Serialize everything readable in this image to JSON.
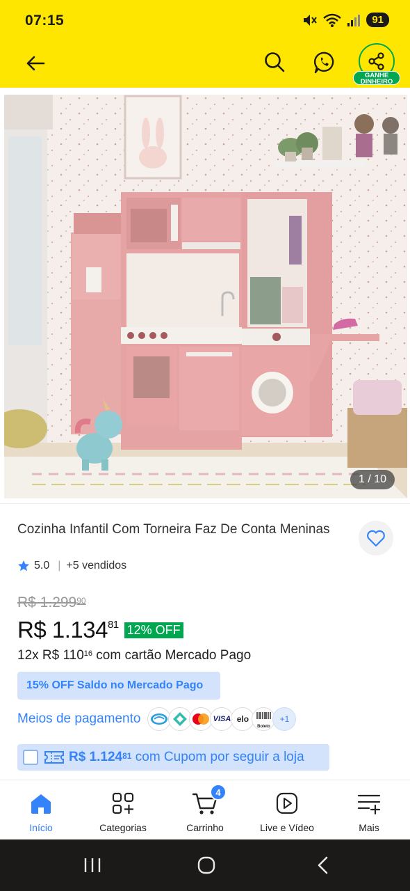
{
  "status_bar": {
    "time": "07:15",
    "battery": "91"
  },
  "header": {
    "earn_badge": [
      "GANHE",
      "DINHEIRO"
    ]
  },
  "gallery": {
    "counter": "1 / 10"
  },
  "product": {
    "title": "Cozinha Infantil Com Torneira Faz De Conta Meninas",
    "rating": "5.0",
    "sold": "+5 vendidos",
    "old_price_main": "R$ 1.299",
    "old_price_cents": "90",
    "price_main": "R$ 1.134",
    "price_cents": "81",
    "discount": "12% OFF",
    "installment_prefix": "12x R$ 110",
    "installment_cents": "16",
    "installment_suffix": " com cartão Mercado Pago",
    "promo": "15% OFF Saldo no Mercado Pago",
    "payment_link": "Meios de pagamento",
    "payment_more": "+1",
    "payment_labels": {
      "visa": "VISA",
      "elo": "elo",
      "boleto": "Boleto"
    },
    "coupon_price": "R$ 1.124",
    "coupon_cents": "81",
    "coupon_suffix": " com Cupom por seguir a loja"
  },
  "bottom_nav": {
    "items": [
      {
        "label": "Início",
        "icon": "home-icon",
        "active": true
      },
      {
        "label": "Categorias",
        "icon": "grid-plus-icon"
      },
      {
        "label": "Carrinho",
        "icon": "cart-icon",
        "badge": "4"
      },
      {
        "label": "Live e Vídeo",
        "icon": "play-icon"
      },
      {
        "label": "Mais",
        "icon": "menu-plus-icon"
      }
    ]
  },
  "colors": {
    "header_yellow": "#ffe600",
    "accent_blue": "#3483fa",
    "green": "#00a650",
    "promo_bg": "#d3e3fb"
  }
}
